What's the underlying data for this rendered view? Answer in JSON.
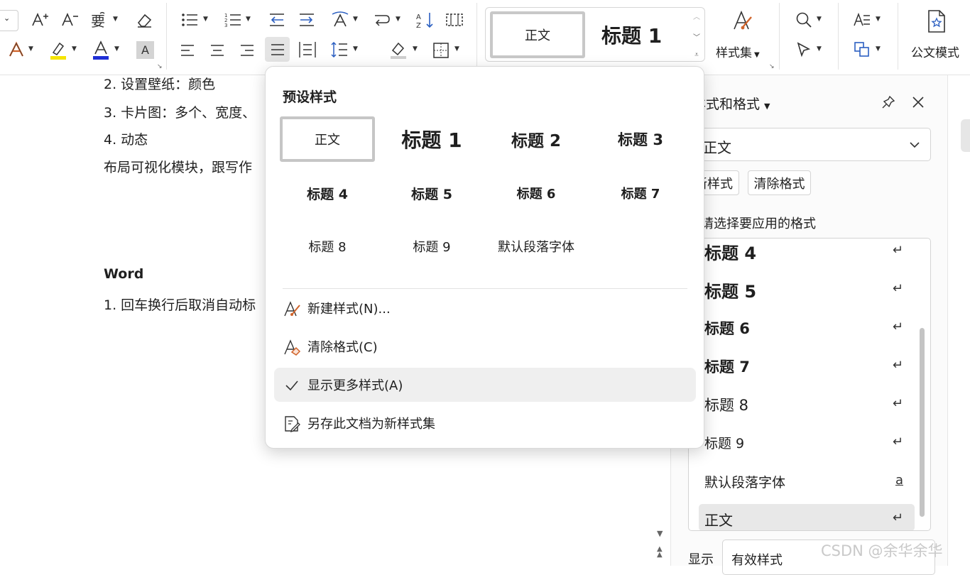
{
  "ribbon": {
    "gallery": {
      "normal": "正文",
      "heading1": "标题 1"
    },
    "style_sets_label": "样式集",
    "official_mode_label": "公文模式",
    "char_shading": "A"
  },
  "document": {
    "lines": [
      "2. 设置壁纸：颜色",
      "3. 卡片图：多个、宽度、",
      "4. 动态",
      "布局可视化模块，跟写作",
      "Word",
      "1. 回车换行后取消自动标"
    ]
  },
  "popup": {
    "title": "预设样式",
    "presets": [
      "正文",
      "标题 1",
      "标题 2",
      "标题 3",
      "标题 4",
      "标题 5",
      "标题 6",
      "标题 7",
      "标题 8",
      "标题 9",
      "默认段落字体"
    ],
    "menu": [
      {
        "label": "新建样式(N)...",
        "icon": "new-style-icon"
      },
      {
        "label": "清除格式(C)",
        "icon": "clear-format-icon"
      },
      {
        "label": "显示更多样式(A)",
        "icon": "check-icon"
      },
      {
        "label": "另存此文档为新样式集",
        "icon": "save-style-set-icon"
      }
    ]
  },
  "pane": {
    "title": "样式和格式",
    "current_style": "正文",
    "new_style_button": "新样式",
    "clear_format_button": "清除格式",
    "hint": "请选择要应用的格式",
    "styles": [
      {
        "label": "标题 4",
        "mark": "↵"
      },
      {
        "label": "标题 5",
        "mark": "↵"
      },
      {
        "label": "标题 6",
        "mark": "↵"
      },
      {
        "label": "标题 7",
        "mark": "↵"
      },
      {
        "label": "标题 8",
        "mark": "↵"
      },
      {
        "label": "标题 9",
        "mark": "↵"
      },
      {
        "label": "默认段落字体",
        "mark": "a"
      },
      {
        "label": "正文",
        "mark": "↵"
      }
    ],
    "show_label": "显示",
    "show_value": "有效样式"
  },
  "watermark": "CSDN @余华余华",
  "colors": {
    "highlight_yellow": "#f5e400",
    "font_blue": "#1f2fd6",
    "accent_blue": "#2b5fc1",
    "icon_orange": "#d0632a"
  }
}
